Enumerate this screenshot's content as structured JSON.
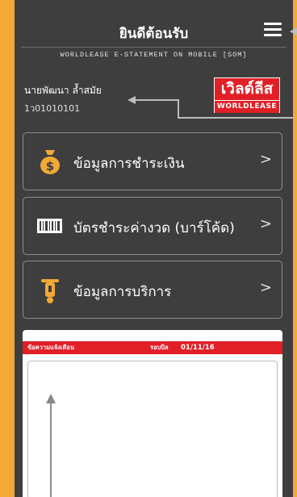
{
  "header": {
    "title": "ยินดีต้อนรับ",
    "subtitle": "WORLDLEASE E-STATEMENT ON MOBILE [SOM]"
  },
  "user": {
    "name": "นายพัฒนา ล้ำสมัย",
    "code": "1ว01010101"
  },
  "logo": {
    "thai": "เวิลด์ลีส",
    "english": "WORLDLEASE"
  },
  "menu": [
    {
      "label": "ข้อมูลการชำระเงิน",
      "icon": "money-bag-icon",
      "chevron": ">"
    },
    {
      "label": "บัตรชำระค่างวด (บาร์โค้ด)",
      "icon": "barcode-icon",
      "chevron": ">"
    },
    {
      "label": "ข้อมูลการบริการ",
      "icon": "scooter-icon",
      "chevron": ">"
    }
  ],
  "statement": {
    "header_left": "ข้อความแจ้งเตือน",
    "period_label": "รอบบิล",
    "period_date": "01/11/16"
  },
  "colors": {
    "frame": "#f2a935",
    "background": "#3e3e3e",
    "accent_red": "#e11f26"
  }
}
